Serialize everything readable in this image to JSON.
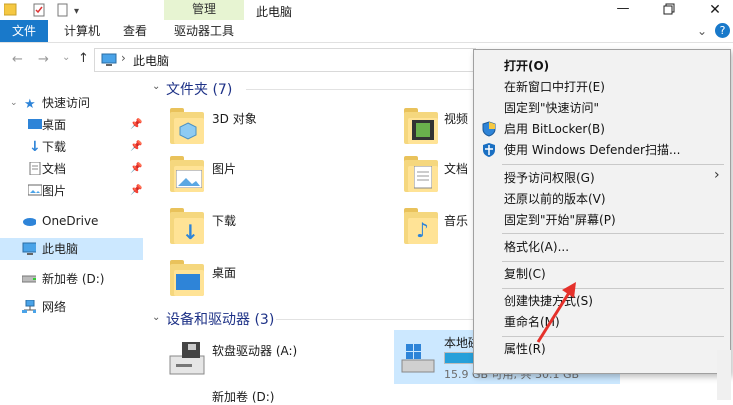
{
  "window": {
    "title": "此电脑",
    "context_tab_group": "管理"
  },
  "ribbon": {
    "tabs": [
      "文件",
      "计算机",
      "查看",
      "驱动器工具"
    ]
  },
  "address": {
    "path_root": "此电脑"
  },
  "sidebar": {
    "items": [
      {
        "label": "快速访问",
        "icon": "star-icon"
      },
      {
        "label": "桌面",
        "icon": "desktop-icon",
        "pinned": true
      },
      {
        "label": "下载",
        "icon": "download-icon",
        "pinned": true
      },
      {
        "label": "文档",
        "icon": "document-icon",
        "pinned": true
      },
      {
        "label": "图片",
        "icon": "picture-icon",
        "pinned": true
      },
      {
        "label": "OneDrive",
        "icon": "cloud-icon"
      },
      {
        "label": "此电脑",
        "icon": "computer-icon",
        "selected": true
      },
      {
        "label": "新加卷 (D:)",
        "icon": "drive-icon"
      },
      {
        "label": "网络",
        "icon": "network-icon"
      }
    ]
  },
  "content": {
    "folders_header": "文件夹 (7)",
    "folders": [
      "3D 对象",
      "视频",
      "图片",
      "文档",
      "下载",
      "音乐",
      "桌面"
    ],
    "drives_header": "设备和驱动器 (3)",
    "drives": [
      {
        "label": "软盘驱动器 (A:)"
      },
      {
        "label": "本地磁",
        "free_text": "15.9 GB 可用, 共 30.1 GB",
        "used_fraction": 0.47
      },
      {
        "label": "新加卷 (D:)"
      }
    ]
  },
  "context_menu": {
    "items": [
      "打开(O)",
      "在新窗口中打开(E)",
      "固定到\"快速访问\"",
      "启用 BitLocker(B)",
      "使用 Windows Defender扫描...",
      "授予访问权限(G)",
      "还原以前的版本(V)",
      "固定到\"开始\"屏幕(P)",
      "格式化(A)...",
      "复制(C)",
      "创建快捷方式(S)",
      "重命名(M)",
      "属性(R)"
    ]
  },
  "colors": {
    "accent": "#1979ca",
    "selection": "#cce8ff",
    "manage_tab": "#e7f4d2",
    "arrow": "#e5312b"
  }
}
